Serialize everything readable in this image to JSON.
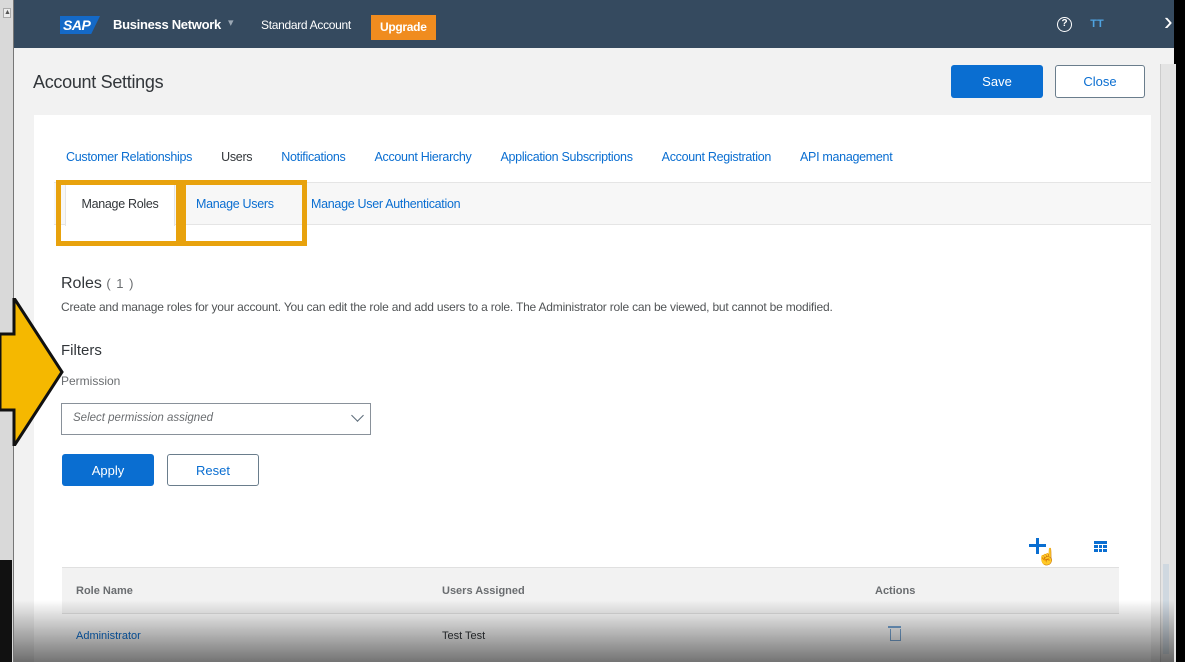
{
  "shell": {
    "logo": "SAP",
    "product": "Business Network",
    "product_chevron": "▾",
    "account_type": "Standard Account",
    "upgrade_label": "Upgrade",
    "help_icon": "?",
    "avatar_initials": "TT"
  },
  "header": {
    "title": "Account Settings",
    "save_label": "Save",
    "close_label": "Close"
  },
  "tabs": [
    {
      "label": "Customer Relationships",
      "active": false
    },
    {
      "label": "Users",
      "active": true
    },
    {
      "label": "Notifications",
      "active": false
    },
    {
      "label": "Account Hierarchy",
      "active": false
    },
    {
      "label": "Application Subscriptions",
      "active": false
    },
    {
      "label": "Account Registration",
      "active": false
    },
    {
      "label": "API management",
      "active": false
    }
  ],
  "subtabs": [
    {
      "label": "Manage Roles",
      "active": true
    },
    {
      "label": "Manage Users",
      "active": false
    },
    {
      "label": "Manage User Authentication",
      "active": false
    }
  ],
  "roles": {
    "title": "Roles",
    "count": "( 1 )",
    "description": "Create and manage roles for your account. You can edit the role and add users to a role. The Administrator role can be viewed, but cannot be modified."
  },
  "filters": {
    "title": "Filters",
    "permission_label": "Permission",
    "permission_placeholder": "Select permission assigned",
    "apply_label": "Apply",
    "reset_label": "Reset"
  },
  "toolbar": {
    "add_icon": "add-icon",
    "table_settings_icon": "table-settings-icon"
  },
  "table": {
    "columns": [
      "Role Name",
      "Users Assigned",
      "Actions"
    ],
    "rows": [
      {
        "role_name": "Administrator",
        "users_assigned": "Test Test",
        "action_icon": "delete-icon"
      }
    ]
  },
  "colors": {
    "shell_bg": "#354a5f",
    "accent": "#0a6ed1",
    "upgrade": "#f08c1f",
    "highlight": "#e8a20d"
  }
}
